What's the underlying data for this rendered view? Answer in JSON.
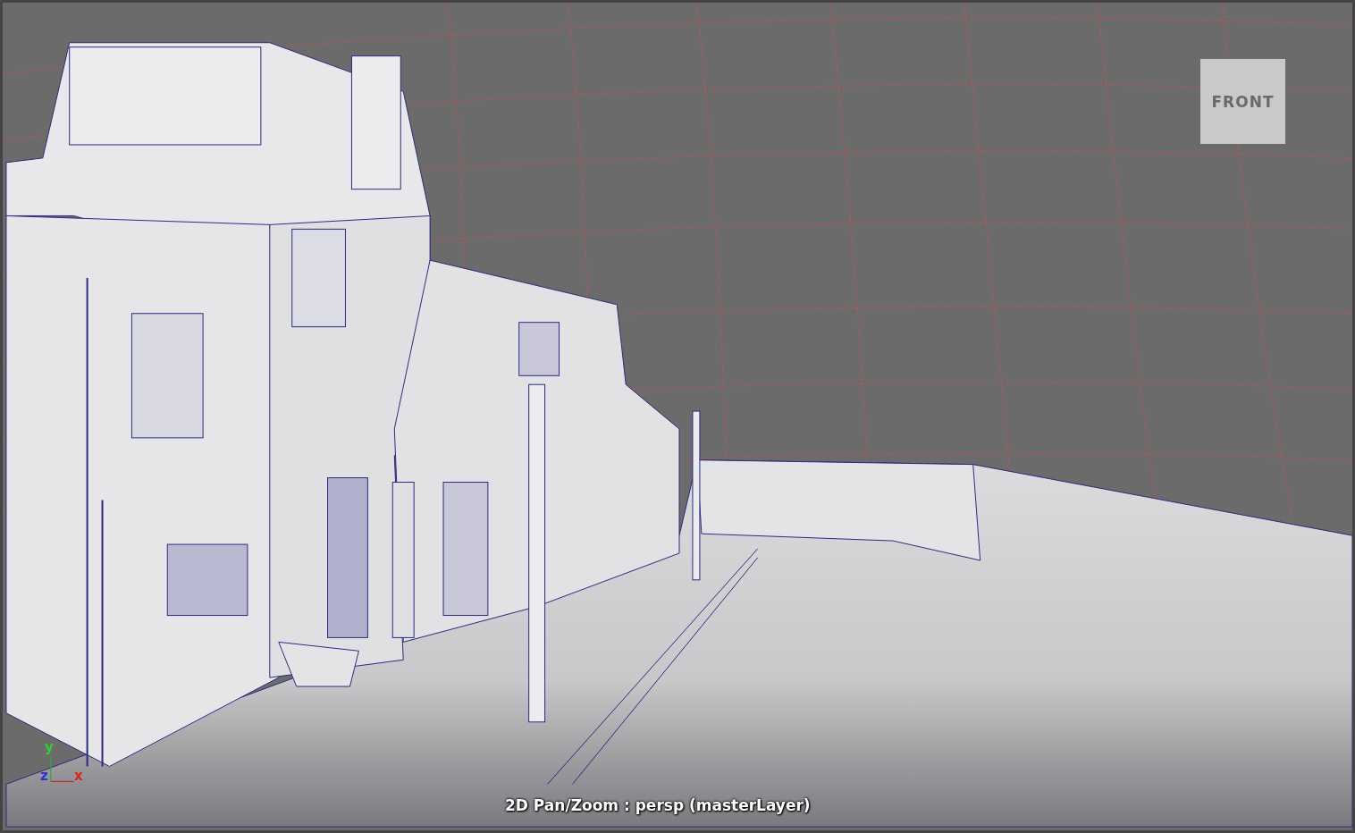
{
  "viewport": {
    "view_cube": {
      "label": "FRONT"
    },
    "axis": {
      "y": "y",
      "z": "z",
      "x": "x"
    },
    "hud_label": "2D Pan/Zoom : persp (masterLayer)"
  }
}
